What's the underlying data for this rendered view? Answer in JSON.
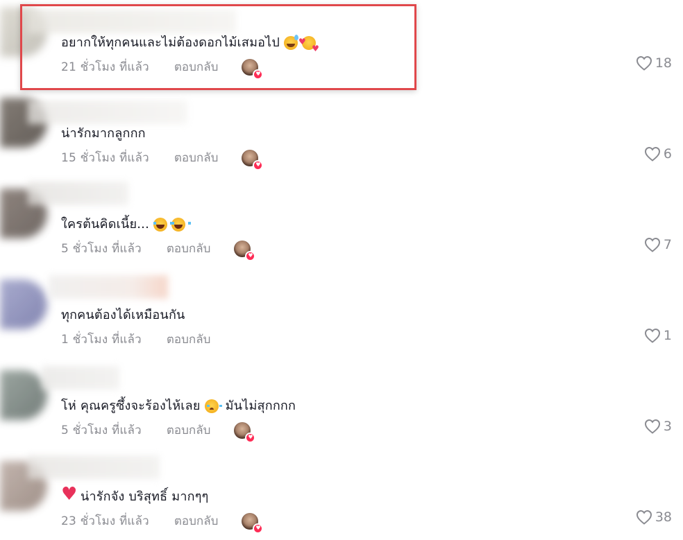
{
  "colors": {
    "text": "#161823",
    "meta": "#8a8b91",
    "badge": "#fe2c55",
    "highlight_border": "#e0484b"
  },
  "comment_actions": {
    "reply_label": "ตอบกลับ"
  },
  "comments": [
    {
      "text": "อยากให้ทุกคนและไม่ต้องดอกไม้เสมอไป",
      "emojis": [
        "smiling-face-with-sweat-emoji",
        "smiling-face-with-hearts-emoji"
      ],
      "time": "21 ชั่วโมง ที่แล้ว",
      "likes": "18",
      "creator_liked": true,
      "highlighted": true
    },
    {
      "text": "น่ารักมากลูกกก",
      "emojis": [],
      "time": "15 ชั่วโมง ที่แล้ว",
      "likes": "6",
      "creator_liked": true
    },
    {
      "text": "ใครต้นคิดเนี้ย...",
      "emojis": [
        "tears-of-joy-emoji",
        "tears-of-joy-emoji"
      ],
      "time": "5 ชั่วโมง ที่แล้ว",
      "likes": "7",
      "creator_liked": true
    },
    {
      "text": "ทุกคนต้องได้เหมือนกัน",
      "emojis": [],
      "time": "1 ชั่วโมง ที่แล้ว",
      "likes": "1",
      "creator_liked": false
    },
    {
      "text_before": "โห่ คุณครูซึ้งจะร้องไห้เลย",
      "emojis": [
        "holding-back-tears-emoji"
      ],
      "text_after": "มันไม่สุกกกก",
      "time": "5 ชั่วโมง ที่แล้ว",
      "likes": "3",
      "creator_liked": true
    },
    {
      "text": "น่ารักจัง บริสุทธิ์ มากๆๆ",
      "emojis": [
        "red-heart-emoji"
      ],
      "time": "23 ชั่วโมง ที่แล้ว",
      "likes": "38",
      "creator_liked": true
    }
  ]
}
